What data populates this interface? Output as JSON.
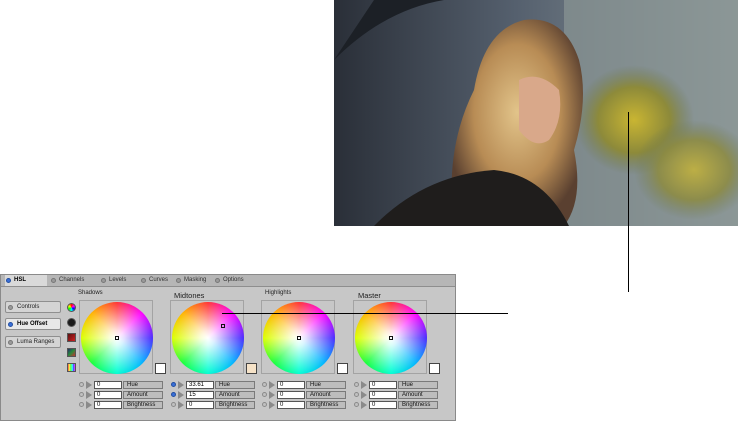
{
  "tabs": [
    {
      "label": "HSL",
      "active": true
    },
    {
      "label": "Channels",
      "active": false
    },
    {
      "label": "Levels",
      "active": false
    },
    {
      "label": "Curves",
      "active": false
    },
    {
      "label": "Masking",
      "active": false
    },
    {
      "label": "Options",
      "active": false
    }
  ],
  "side_buttons": [
    {
      "label": "Controls",
      "active": false
    },
    {
      "label": "Hue Offset",
      "active": true
    },
    {
      "label": "Luma Ranges",
      "active": false
    }
  ],
  "tool_icons": [
    "color-wheel-icon",
    "dark-circle-icon",
    "red-swatch-icon",
    "gradient-swatch-icon",
    "spectrum-swatch-icon"
  ],
  "wheels": [
    {
      "label": "Shadows",
      "swatch_color": "#ffffff",
      "hue": "0",
      "amount": "0",
      "brightness": "0",
      "hue_active": false,
      "amount_active": false
    },
    {
      "label": "Midtones",
      "swatch_color": "#f6e3c8",
      "hue": "33.61",
      "amount": "15",
      "brightness": "0",
      "hue_active": true,
      "amount_active": true
    },
    {
      "label": "Highlights",
      "swatch_color": "#ffffff",
      "hue": "0",
      "amount": "0",
      "brightness": "0",
      "hue_active": false,
      "amount_active": false
    },
    {
      "label": "Master",
      "swatch_color": "#ffffff",
      "hue": "0",
      "amount": "0",
      "brightness": "0",
      "hue_active": false,
      "amount_active": false
    }
  ],
  "field_labels": {
    "hue": "Hue",
    "amount": "Amount",
    "brightness": "Brightness"
  }
}
